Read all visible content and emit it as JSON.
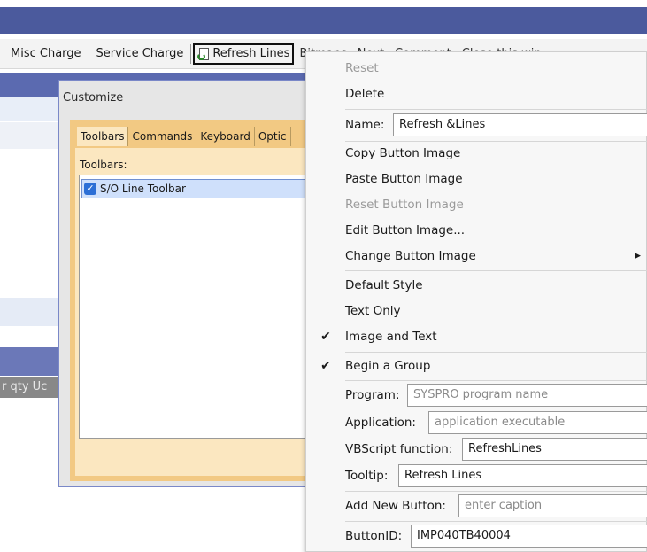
{
  "toolbar": {
    "misc_charge": "Misc Charge",
    "service_charge": "Service Charge",
    "refresh_lines": "Refresh Lines",
    "bitmaps": "Bitmaps",
    "next": "Next",
    "comment": "Comment",
    "close": "Close this win"
  },
  "grid": {
    "header_text": "r qty Uc"
  },
  "dialog": {
    "title": "Customize",
    "tabs": [
      "Toolbars",
      "Commands",
      "Keyboard",
      "Optic"
    ],
    "toolbars_label": "Toolbars:",
    "toolbar_item": "S/O Line Toolbar",
    "toolbar_item_checked": true
  },
  "menu": {
    "reset": "Reset",
    "delete": "Delete",
    "name_label": "Name:",
    "name_value": "Refresh &Lines",
    "copy_image": "Copy Button Image",
    "paste_image": "Paste Button Image",
    "reset_image": "Reset Button Image",
    "edit_image": "Edit Button Image...",
    "change_image": "Change Button Image",
    "default_style": "Default Style",
    "text_only": "Text Only",
    "image_and_text": "Image and Text",
    "begin_group": "Begin a Group",
    "program_label": "Program:",
    "program_placeholder": "SYSPRO program name",
    "application_label": "Application:",
    "application_placeholder": "application executable",
    "vbscript_label": "VBScript function:",
    "vbscript_value": "RefreshLines",
    "tooltip_label": "Tooltip:",
    "tooltip_value": "Refresh Lines",
    "add_button_label": "Add New Button:",
    "add_button_placeholder": "enter caption",
    "buttonid_label": "ButtonID:",
    "buttonid_value": "IMP040TB40004"
  },
  "colors": {
    "title_bar": "#4b5a9d",
    "dialog_panel": "#f2c983",
    "selection": "#cfe0fb",
    "check_blue": "#2c6fd6"
  }
}
